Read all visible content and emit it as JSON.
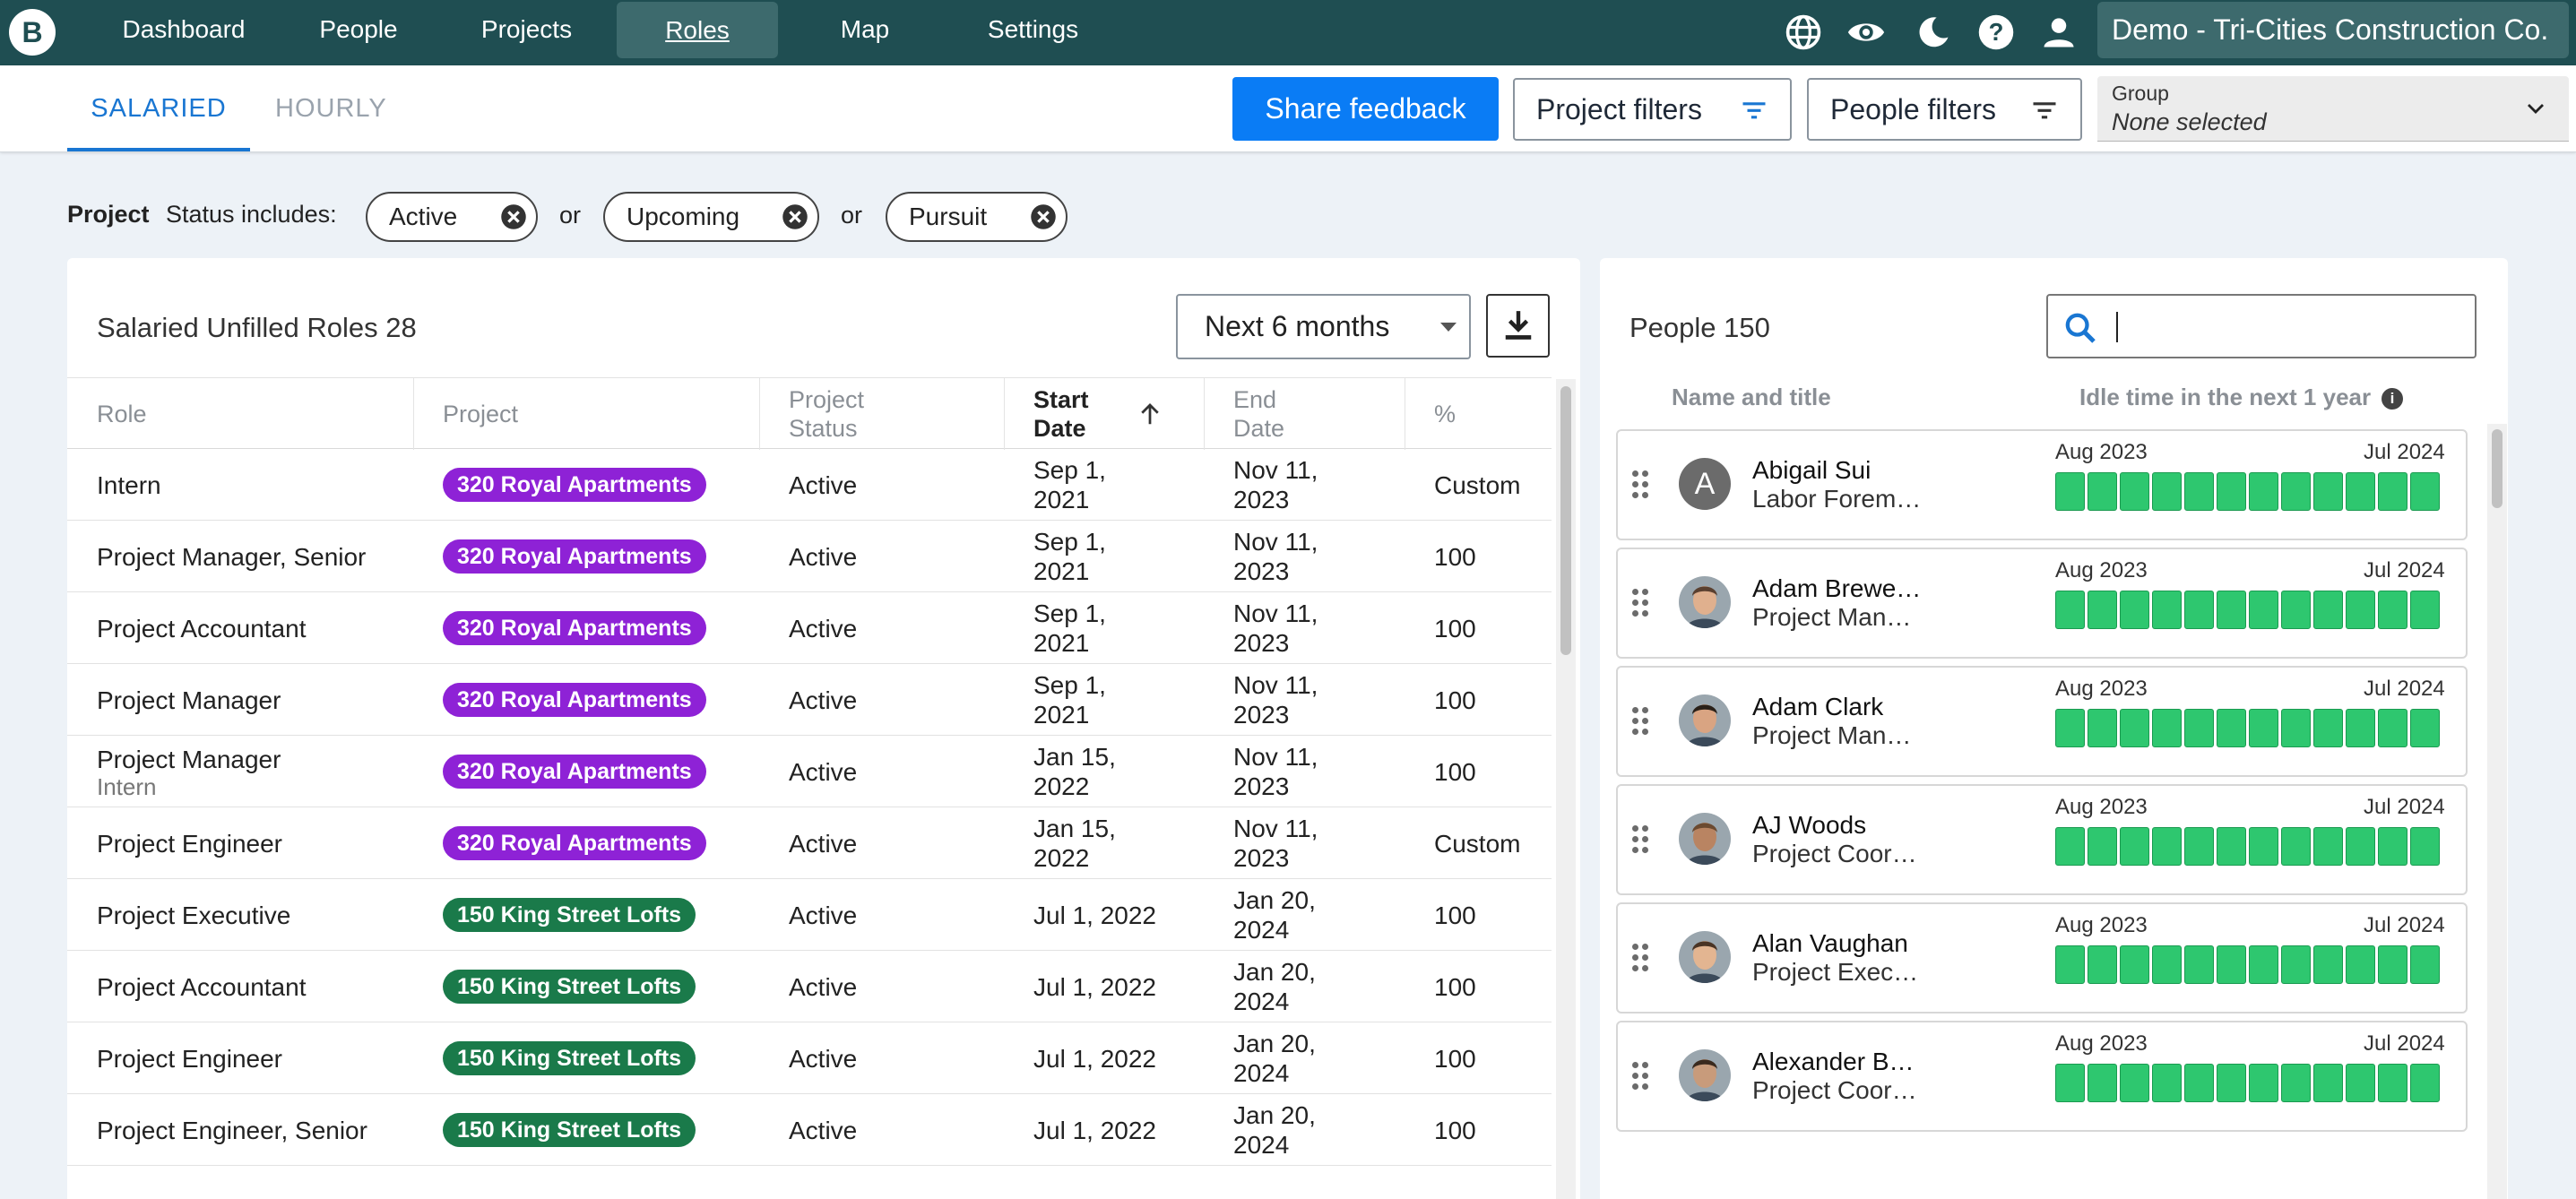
{
  "nav": {
    "logo_letter": "B",
    "items": [
      {
        "label": "Dashboard"
      },
      {
        "label": "People"
      },
      {
        "label": "Projects"
      },
      {
        "label": "Roles"
      },
      {
        "label": "Map"
      },
      {
        "label": "Settings"
      }
    ],
    "active_item": "Roles",
    "icons": [
      "globe-icon",
      "eye-icon",
      "moon-icon",
      "help-icon",
      "user-icon"
    ],
    "tenant": "Demo - Tri-Cities Construction Co."
  },
  "subbar": {
    "tabs": [
      {
        "label": "SALARIED"
      },
      {
        "label": "HOURLY"
      }
    ],
    "active_tab": "SALARIED",
    "share_feedback": "Share feedback",
    "project_filters": "Project filters",
    "people_filters": "People filters",
    "group_label": "Group",
    "group_value": "None selected"
  },
  "filters": {
    "project_label": "Project",
    "status_label": "Status includes:",
    "chips": [
      {
        "label": "Active"
      },
      {
        "label": "Upcoming"
      },
      {
        "label": "Pursuit"
      }
    ],
    "separator": "or"
  },
  "roles": {
    "title": "Salaried Unfilled Roles 28",
    "range": "Next 6 months",
    "columns": {
      "role": "Role",
      "project": "Project",
      "status": "Project Status",
      "start": "Start Date",
      "end": "End Date",
      "percent": "%"
    },
    "sort_column": "Start Date",
    "sort_direction": "ascending",
    "rows": [
      {
        "role": "Intern",
        "sub": "",
        "project": "320 Royal Apartments",
        "color": "#8e22d6",
        "status": "Active",
        "start": "Sep 1, 2021",
        "end": "Nov 11, 2023",
        "percent": "Custom"
      },
      {
        "role": "Project Manager, Senior",
        "sub": "",
        "project": "320 Royal Apartments",
        "color": "#8e22d6",
        "status": "Active",
        "start": "Sep 1, 2021",
        "end": "Nov 11, 2023",
        "percent": "100"
      },
      {
        "role": "Project Accountant",
        "sub": "",
        "project": "320 Royal Apartments",
        "color": "#8e22d6",
        "status": "Active",
        "start": "Sep 1, 2021",
        "end": "Nov 11, 2023",
        "percent": "100"
      },
      {
        "role": "Project Manager",
        "sub": "",
        "project": "320 Royal Apartments",
        "color": "#8e22d6",
        "status": "Active",
        "start": "Sep 1, 2021",
        "end": "Nov 11, 2023",
        "percent": "100"
      },
      {
        "role": "Project Manager",
        "sub": "Intern",
        "project": "320 Royal Apartments",
        "color": "#8e22d6",
        "status": "Active",
        "start": "Jan 15, 2022",
        "end": "Nov 11, 2023",
        "percent": "100"
      },
      {
        "role": "Project Engineer",
        "sub": "",
        "project": "320 Royal Apartments",
        "color": "#8e22d6",
        "status": "Active",
        "start": "Jan 15, 2022",
        "end": "Nov 11, 2023",
        "percent": "Custom"
      },
      {
        "role": "Project Executive",
        "sub": "",
        "project": "150 King Street Lofts",
        "color": "#1a7a4a",
        "status": "Active",
        "start": "Jul 1, 2022",
        "end": "Jan 20, 2024",
        "percent": "100"
      },
      {
        "role": "Project Accountant",
        "sub": "",
        "project": "150 King Street Lofts",
        "color": "#1a7a4a",
        "status": "Active",
        "start": "Jul 1, 2022",
        "end": "Jan 20, 2024",
        "percent": "100"
      },
      {
        "role": "Project Engineer",
        "sub": "",
        "project": "150 King Street Lofts",
        "color": "#1a7a4a",
        "status": "Active",
        "start": "Jul 1, 2022",
        "end": "Jan 20, 2024",
        "percent": "100"
      },
      {
        "role": "Project Engineer, Senior",
        "sub": "",
        "project": "150 King Street Lofts",
        "color": "#1a7a4a",
        "status": "Active",
        "start": "Jul 1, 2022",
        "end": "Jan 20, 2024",
        "percent": "100"
      }
    ]
  },
  "people": {
    "title": "People 150",
    "search_value": "",
    "col_name": "Name and title",
    "col_idle": "Idle time in the next 1 year",
    "info_glyph": "i",
    "month_start": "Aug 2023",
    "month_end": "Jul 2024",
    "bar_color": "#2ec76f",
    "list": [
      {
        "name": "Abigail Sui",
        "title": "Labor Forem…",
        "initial": "A",
        "photo": false
      },
      {
        "name": "Adam Brewe…",
        "title": "Project Man…",
        "initial": "",
        "photo": true
      },
      {
        "name": "Adam Clark",
        "title": "Project Man…",
        "initial": "",
        "photo": true
      },
      {
        "name": "AJ Woods",
        "title": "Project Coor…",
        "initial": "",
        "photo": true
      },
      {
        "name": "Alan Vaughan",
        "title": "Project Exec…",
        "initial": "",
        "photo": true
      },
      {
        "name": "Alexander B…",
        "title": "Project Coor…",
        "initial": "",
        "photo": true
      }
    ]
  }
}
